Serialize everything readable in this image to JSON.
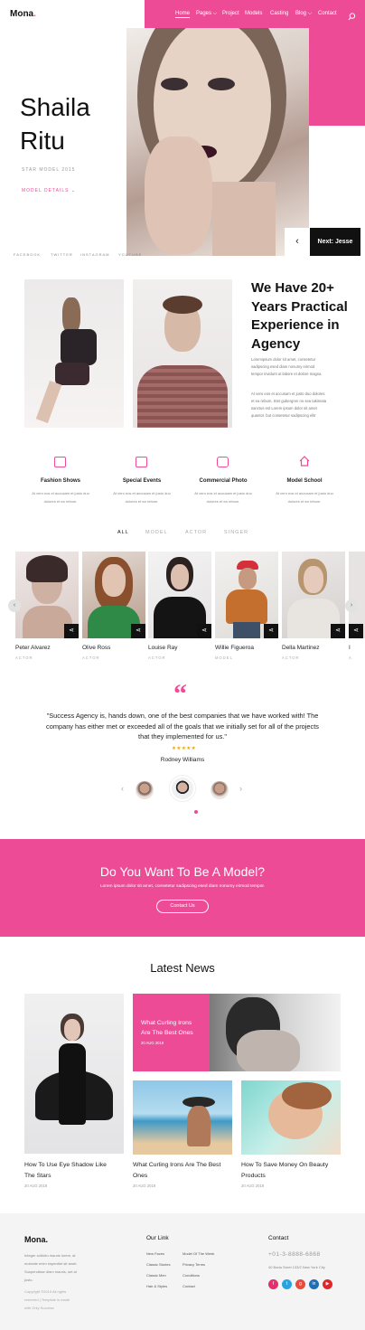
{
  "brand": {
    "name": "Mona",
    "dot": "."
  },
  "nav": {
    "items": [
      {
        "label": "Home",
        "active": true
      },
      {
        "label": "Pages ⌵"
      },
      {
        "label": "Project"
      },
      {
        "label": "Models"
      },
      {
        "label": "Casting"
      },
      {
        "label": "Blog ⌵"
      },
      {
        "label": "Contact"
      }
    ],
    "search_icon": "search-icon"
  },
  "hero": {
    "name_line1": "Shaila",
    "name_line2": "Ritu",
    "subtitle": "STAR MODEL 2015",
    "details_link": "MODEL DETAILS  ⌄",
    "social": [
      "FACEBOOK",
      "TWITTER",
      "INSTAGRAM",
      "YOUTUBE"
    ],
    "prev_arrow": "‹",
    "next_label": "Next: Jesse"
  },
  "about": {
    "heading": [
      "We Have 20+",
      "Years Practical",
      "Experience in",
      "Agency"
    ],
    "para1": [
      "Loremipsum dolor sit amet, consetetur",
      "sadipscing esed diam nonumy eirmod",
      "tempor invidunt ut labore et dolore magna"
    ],
    "para2": [
      "At vero eos et accusam et justo duo dolores",
      "et ea rebum. Stet gubergren no sea takimata",
      "sanctus est Lorem ipsum dolor sit amet",
      "quantor. but consetetur sadipscing elitr"
    ]
  },
  "services": [
    {
      "icon": "film-icon",
      "title": "Fashion Shows",
      "text": [
        "At vero eos et accusam et justo duo",
        "dolores et ea rebum."
      ]
    },
    {
      "icon": "calendar-icon",
      "title": "Special Events",
      "text": [
        "At vero eos et accusam et justo duo",
        "dolores et ea rebum."
      ]
    },
    {
      "icon": "camera-icon",
      "title": "Commercial Photo",
      "text": [
        "At vero eos et accusam et justo duo",
        "dolores et ea rebum."
      ]
    },
    {
      "icon": "home-icon",
      "title": "Model School",
      "text": [
        "At vero eos et accusam et justo duo",
        "dolores et ea rebum."
      ]
    }
  ],
  "filters": [
    "ALL",
    "MODEL",
    "ACTOR",
    "SINGER"
  ],
  "models": [
    {
      "name": "Peter Alvarez",
      "role": "ACTOR"
    },
    {
      "name": "Olive Ross",
      "role": "ACTOR"
    },
    {
      "name": "Louise Ray",
      "role": "ACTOR"
    },
    {
      "name": "Willie Figueroa",
      "role": "MODEL"
    },
    {
      "name": "Della Martinez",
      "role": "ACTOR"
    },
    {
      "name": "I",
      "role": "A"
    }
  ],
  "testimonial": {
    "quote_mark": "“",
    "text": "\"Success Agency is, hands down, one of the best companies that we have worked with! The company has either met or exceeded all of the goals that we initially set for all of the projects that they implemented for us.\"",
    "stars": "★★★★★",
    "author": "Rodney Williams",
    "prev": "‹",
    "next": "›"
  },
  "cta": {
    "heading": "Do You Want To Be A Model?",
    "text": "Lorem ipsum dolor sit amet, consetetur sadipscing esed diam nonumy eirmod tempor.",
    "button": "Contact Us"
  },
  "news": {
    "heading": "Latest News",
    "featured": {
      "title": [
        "What Curling Irons",
        "Are The Best Ones"
      ],
      "date": "20 AUG 2019"
    },
    "posts": [
      {
        "title": [
          "How To Use Eye Shadow Like",
          "The Stars"
        ],
        "date": "20 AUG 2019"
      },
      {
        "title": [
          "What Curling Irons Are The Best",
          "Ones"
        ],
        "date": "20 AUG 2019"
      },
      {
        "title": [
          "How To Save Money On Beauty",
          "Products"
        ],
        "date": "20 AUG 2019"
      }
    ]
  },
  "footer": {
    "brand": "Mona.",
    "about": [
      "Integer sollicitu mauris lorem, at",
      "molestie enim imperdiet sit amet.",
      "Suspendisse diam mauris, set at",
      "justo."
    ],
    "copyright": [
      "Copyright ©2019 All rights",
      "reserved | Template is made",
      "with Only Success"
    ],
    "links_heading": "Our Link",
    "links_col1": [
      "New Faces",
      "Classic Stories",
      "Classic Men",
      "Hair & Styles"
    ],
    "links_col2": [
      "Model Of The Week",
      "Privacy Terms",
      "Conditions",
      "Contact"
    ],
    "contact_heading": "Contact",
    "phone": "+01-3-8888-6868",
    "address": "40 Baria Sreet 133/2 New York City",
    "social": [
      {
        "icon": "facebook-icon",
        "glyph": "f",
        "color": "#e62d6f"
      },
      {
        "icon": "twitter-icon",
        "glyph": "t",
        "color": "#29a3e0"
      },
      {
        "icon": "google-icon",
        "glyph": "g",
        "color": "#e74c3c"
      },
      {
        "icon": "linkedin-icon",
        "glyph": "in",
        "color": "#1f6fb4"
      },
      {
        "icon": "youtube-icon",
        "glyph": "▶",
        "color": "#e0262b"
      }
    ]
  }
}
